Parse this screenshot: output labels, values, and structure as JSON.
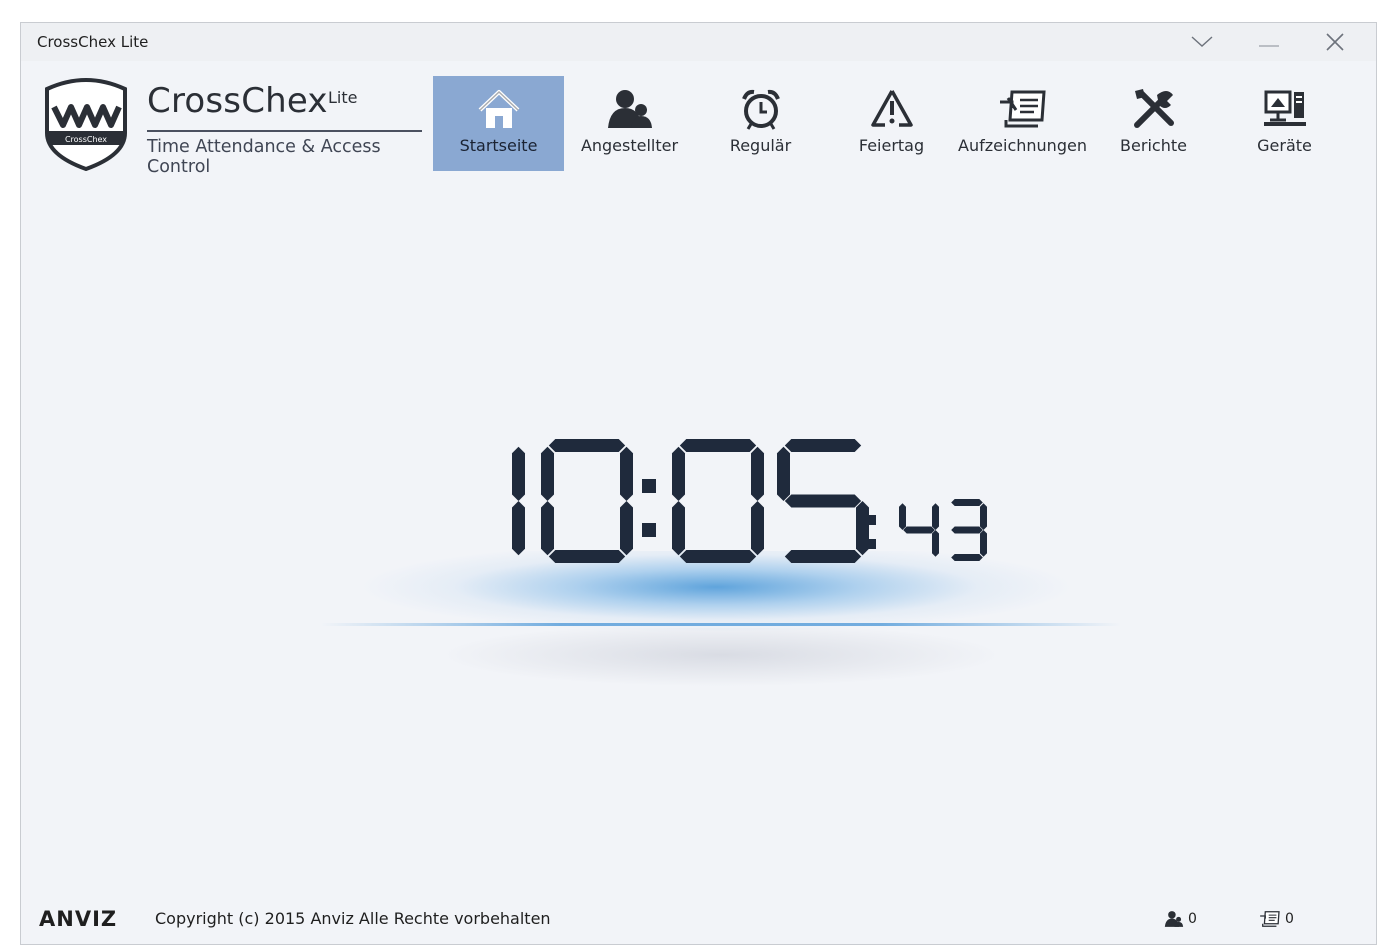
{
  "window": {
    "title": "CrossChex Lite"
  },
  "brand": {
    "name": "CrossChex",
    "edition": "Lite",
    "tagline": "Time Attendance & Access Control",
    "logo_text": "CrossChex"
  },
  "nav": {
    "items": [
      {
        "label": "Startseite",
        "icon": "home-icon",
        "active": true
      },
      {
        "label": "Angestellter",
        "icon": "users-icon",
        "active": false
      },
      {
        "label": "Regulär",
        "icon": "alarm-clock-icon",
        "active": false
      },
      {
        "label": "Feiertag",
        "icon": "warning-icon",
        "active": false
      },
      {
        "label": "Aufzeichnungen",
        "icon": "records-icon",
        "active": false
      },
      {
        "label": "Berichte",
        "icon": "tools-icon",
        "active": false
      },
      {
        "label": "Geräte",
        "icon": "devices-icon",
        "active": false
      }
    ]
  },
  "clock": {
    "hours": "10",
    "minutes": "05",
    "seconds": "43"
  },
  "footer": {
    "brand": "ANVIZ",
    "copyright": "Copyright (c) 2015 Anviz Alle Rechte vorbehalten",
    "employee_count": "0",
    "record_count": "0"
  },
  "colors": {
    "active_tab": "#8aa8d2",
    "digit": "#1f2a3c",
    "background": "#f2f4f8",
    "glow": "#4696d7"
  }
}
